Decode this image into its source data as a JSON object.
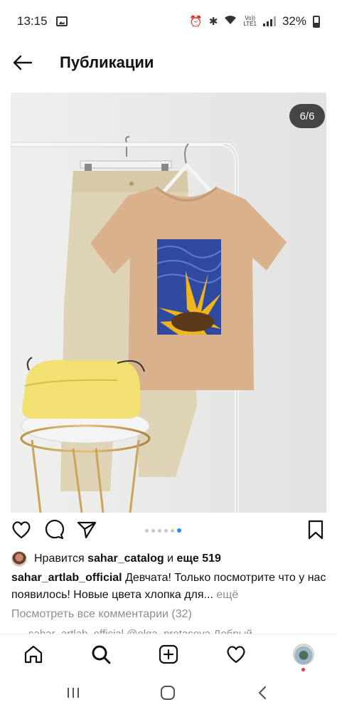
{
  "status_bar": {
    "time": "13:15",
    "volte": "Vo))\nLTE1",
    "battery": "32%"
  },
  "header": {
    "title": "Публикации"
  },
  "post": {
    "counter": "6/6",
    "slide_count": 6,
    "active_slide": 6
  },
  "likes": {
    "prefix": "Нравится",
    "user": "sahar_catalog",
    "and": "и",
    "others": "еще 519"
  },
  "caption": {
    "author": "sahar_artlab_official",
    "text": " Девчата! Только посмотрите что у нас появилось! Новые цвета хлопка для...",
    "more": " ещё"
  },
  "comments": {
    "view_all": "Посмотреть все комментарии (32)",
    "peek": "sahar_artlab_official @olga_protasova Добрый"
  },
  "colors": {
    "accent_blue": "#2b8cf2",
    "notification_red": "#ff3040",
    "muted_text": "#8e8e8e"
  }
}
